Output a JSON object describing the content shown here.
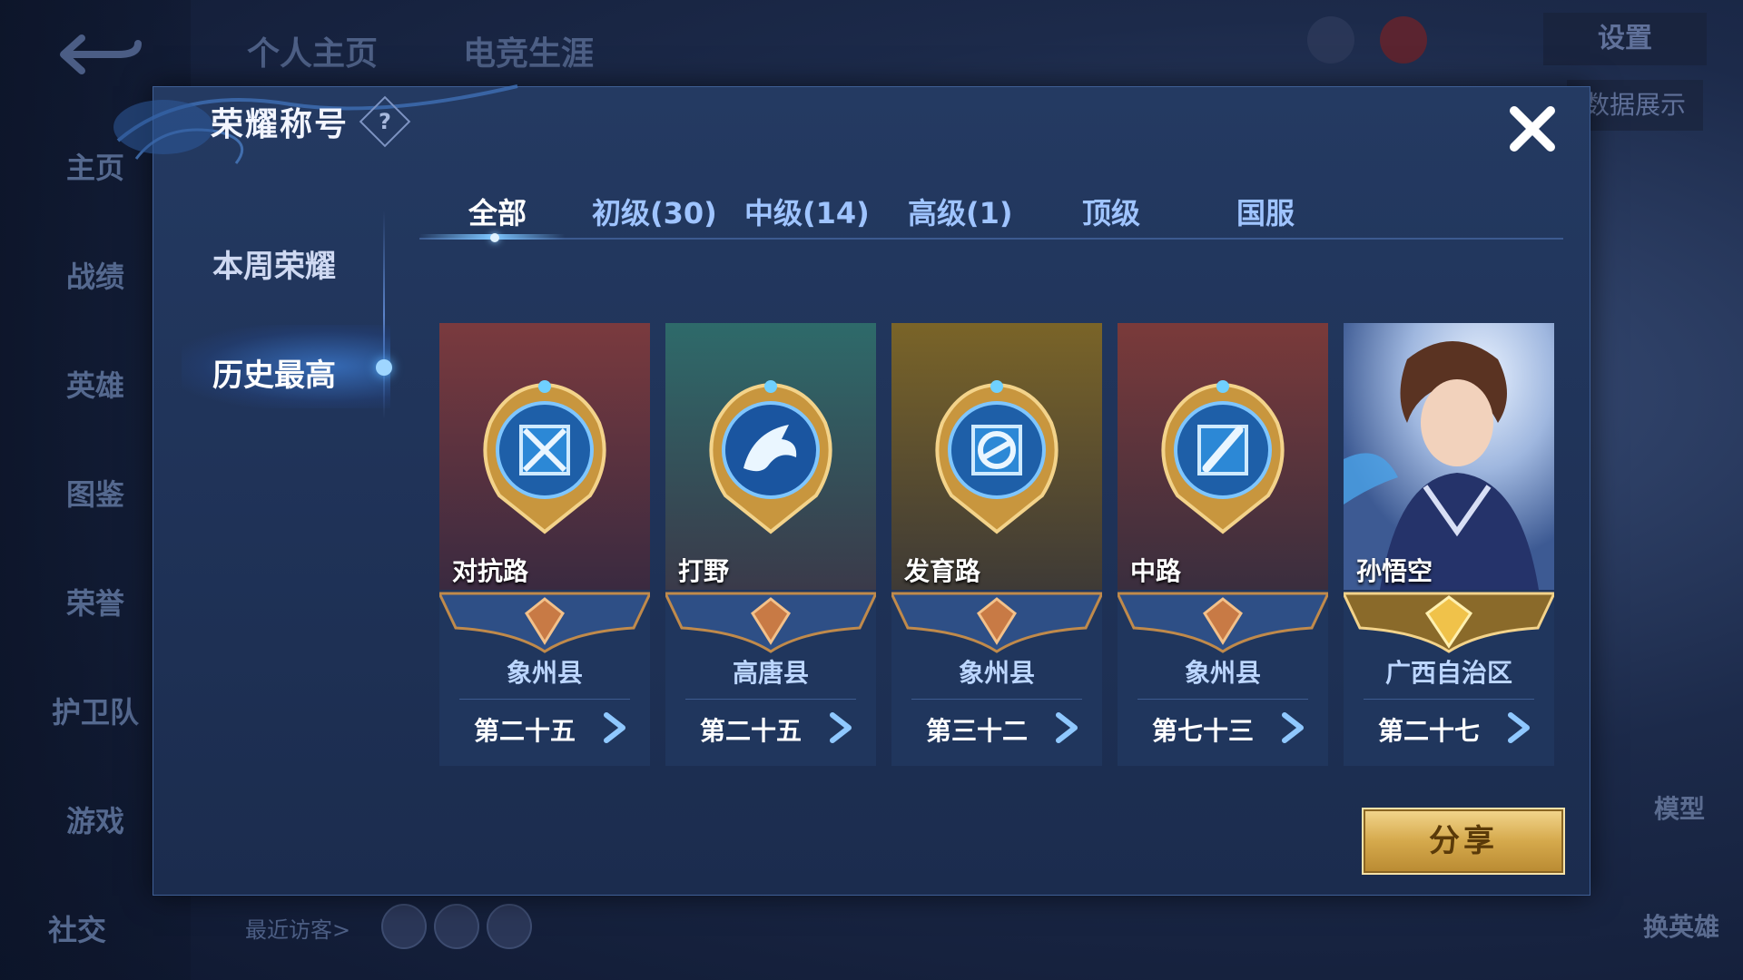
{
  "background": {
    "top_tabs": [
      "个人主页",
      "电竞生涯"
    ],
    "left_nav": [
      "主页",
      "战绩",
      "英雄",
      "图鉴",
      "荣誉",
      "护卫队",
      "游戏",
      "社交"
    ],
    "recent_visitors_label": "最近访客>",
    "settings_label": "设置",
    "data_show_label": "数据展示",
    "model_label": "模型",
    "switch_hero_label": "换英雄"
  },
  "dialog": {
    "title": "荣耀称号",
    "help_glyph": "?",
    "side_menu": [
      {
        "label": "本周荣耀",
        "active": false
      },
      {
        "label": "历史最高",
        "active": true
      }
    ],
    "tabs": [
      {
        "label": "全部",
        "active": true
      },
      {
        "label": "初级(30)",
        "active": false
      },
      {
        "label": "中级(14)",
        "active": false
      },
      {
        "label": "高级(1)",
        "active": false
      },
      {
        "label": "顶级",
        "active": false
      },
      {
        "label": "国服",
        "active": false
      }
    ],
    "cards": [
      {
        "role": "对抗路",
        "region": "象州县",
        "rank": "第二十五",
        "emblem": "sword-emblem-icon",
        "tier": "bronze"
      },
      {
        "role": "打野",
        "region": "高唐县",
        "rank": "第二十五",
        "emblem": "dragon-emblem-icon",
        "tier": "bronze"
      },
      {
        "role": "发育路",
        "region": "象州县",
        "rank": "第三十二",
        "emblem": "swirl-emblem-icon",
        "tier": "bronze"
      },
      {
        "role": "中路",
        "region": "象州县",
        "rank": "第七十三",
        "emblem": "wand-emblem-icon",
        "tier": "bronze"
      },
      {
        "role": "孙悟空",
        "region": "广西自治区",
        "rank": "第二十七",
        "emblem": "hero-portrait",
        "tier": "gold"
      }
    ],
    "share_label": "分享"
  }
}
